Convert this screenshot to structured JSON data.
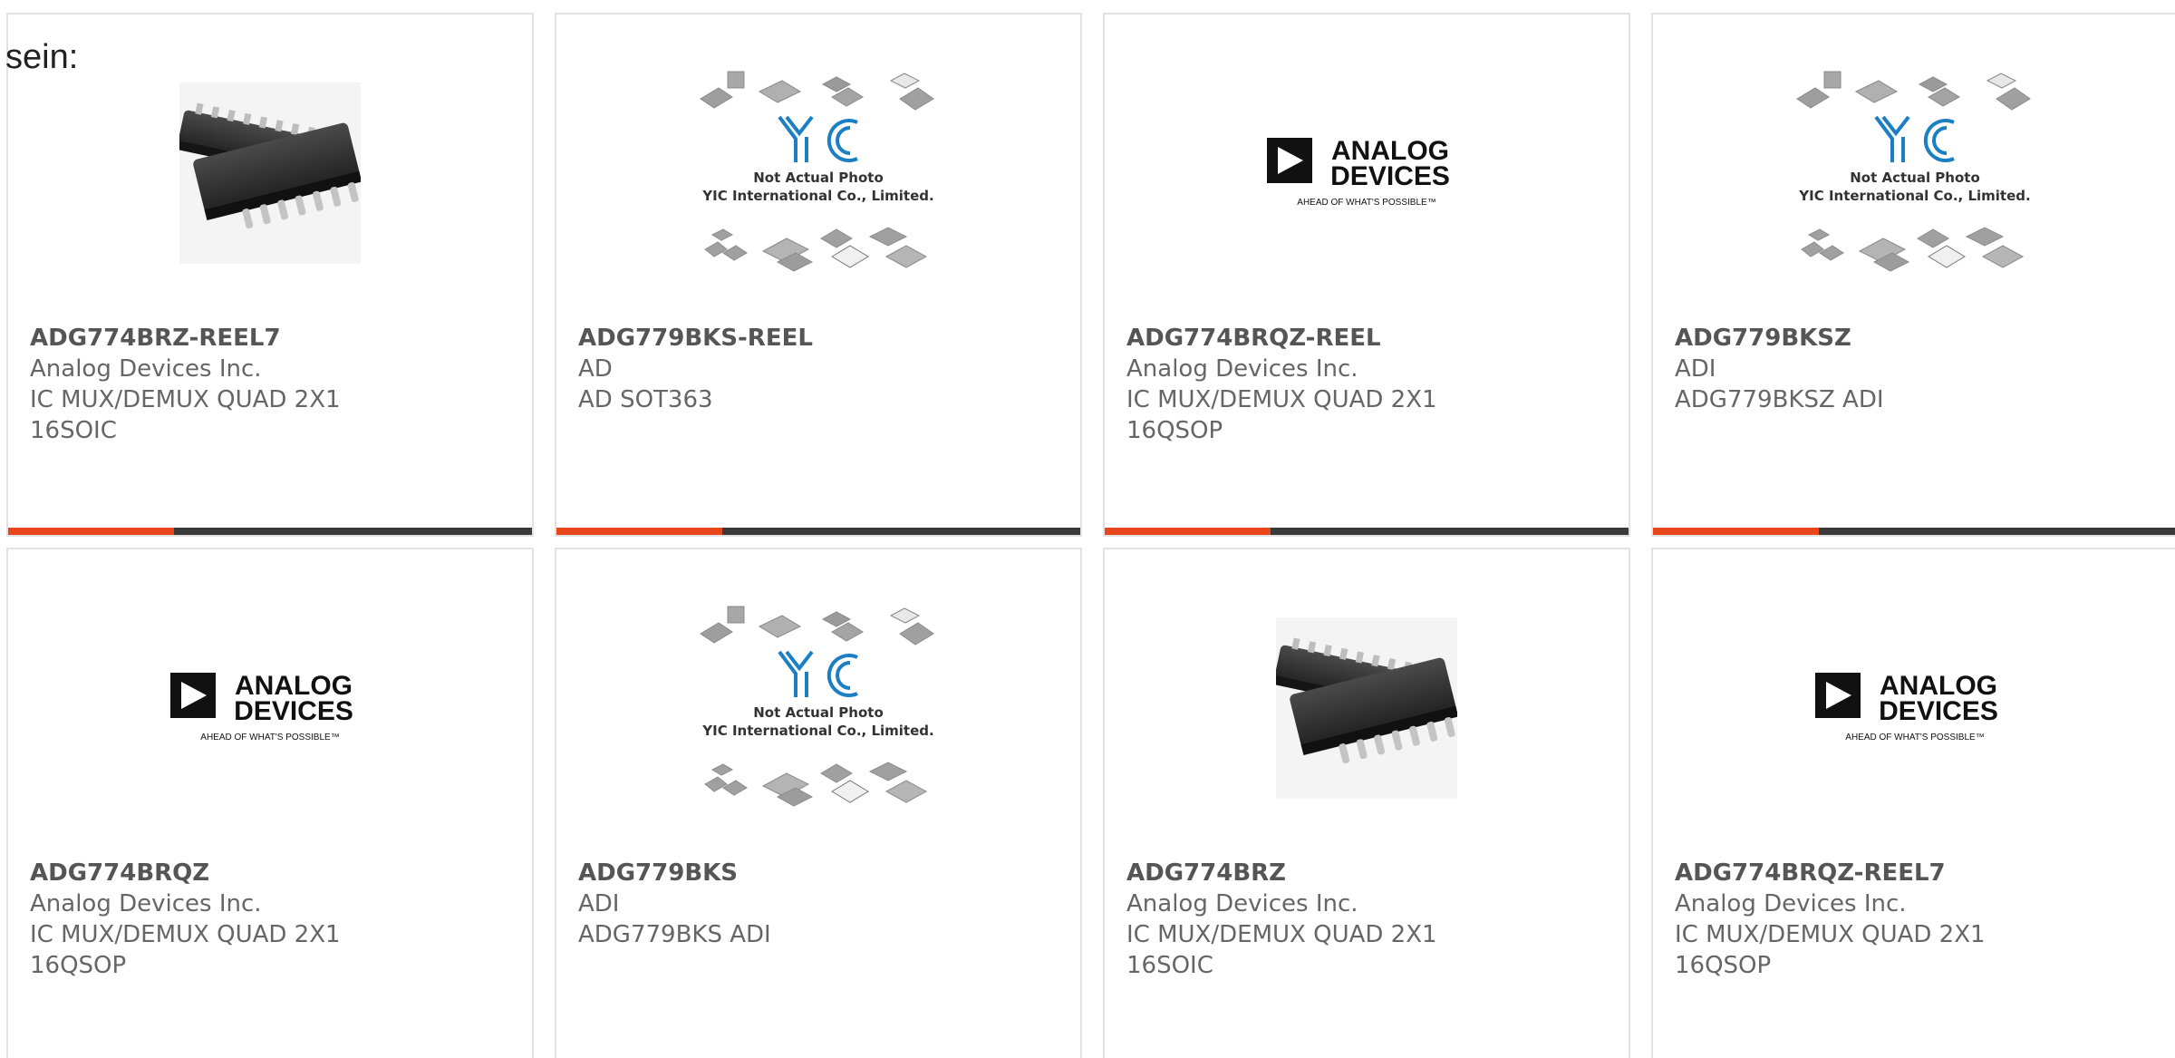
{
  "intro": {
    "text": "sein:"
  },
  "colors": {
    "accent": "#e8471b",
    "bar": "#3a3a3a"
  },
  "image_labels": {
    "yic_line1": "Not Actual Photo",
    "yic_line2": "YIC International Co., Limited.",
    "adi_line1": "ANALOG",
    "adi_line2": "DEVICES",
    "adi_tagline": "AHEAD OF WHAT'S POSSIBLE™"
  },
  "products": [
    {
      "part": "ADG774BRZ-REEL7",
      "maker": "Analog Devices Inc.",
      "desc1": "IC MUX/DEMUX QUAD 2X1",
      "desc2": "16SOIC",
      "image": "ic-chip"
    },
    {
      "part": "ADG779BKS-REEL",
      "maker": "AD",
      "desc1": "AD SOT363",
      "desc2": "",
      "image": "yic-placeholder"
    },
    {
      "part": "ADG774BRQZ-REEL",
      "maker": "Analog Devices Inc.",
      "desc1": "IC MUX/DEMUX QUAD 2X1",
      "desc2": "16QSOP",
      "image": "analog-devices-logo"
    },
    {
      "part": "ADG779BKSZ",
      "maker": "ADI",
      "desc1": "ADG779BKSZ ADI",
      "desc2": "",
      "image": "yic-placeholder"
    },
    {
      "part": "ADG774BRQZ",
      "maker": "Analog Devices Inc.",
      "desc1": "IC MUX/DEMUX QUAD 2X1",
      "desc2": "16QSOP",
      "image": "analog-devices-logo"
    },
    {
      "part": "ADG779BKS",
      "maker": "ADI",
      "desc1": "ADG779BKS ADI",
      "desc2": "",
      "image": "yic-placeholder"
    },
    {
      "part": "ADG774BRZ",
      "maker": "Analog Devices Inc.",
      "desc1": "IC MUX/DEMUX QUAD 2X1",
      "desc2": "16SOIC",
      "image": "ic-chip"
    },
    {
      "part": "ADG774BRQZ-REEL7",
      "maker": "Analog Devices Inc.",
      "desc1": "IC MUX/DEMUX QUAD 2X1",
      "desc2": "16QSOP",
      "image": "analog-devices-logo"
    }
  ]
}
